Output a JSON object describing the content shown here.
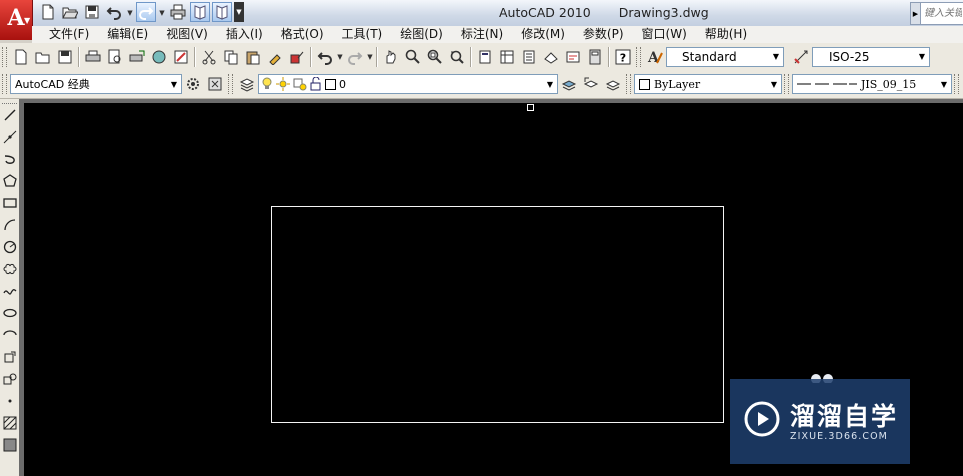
{
  "window": {
    "app_name": "AutoCAD 2010",
    "document": "Drawing3.dwg",
    "search_placeholder": "键入关键字或短语"
  },
  "menubar": {
    "items": [
      "文件(F)",
      "编辑(E)",
      "视图(V)",
      "插入(I)",
      "格式(O)",
      "工具(T)",
      "绘图(D)",
      "标注(N)",
      "修改(M)",
      "参数(P)",
      "窗口(W)",
      "帮助(H)"
    ]
  },
  "styles_toolbar": {
    "text_style": "Standard",
    "dim_style": "ISO-25"
  },
  "workspace_toolbar": {
    "workspace": "AutoCAD 经典",
    "layer": "0",
    "color": "ByLayer",
    "linetype": "JIS_09_15"
  },
  "watermark": {
    "title": "溜溜自学",
    "url": "ZIXUE.3D66.COM"
  },
  "colors": {
    "canvas": "#000000",
    "logo_red": "#c8201a",
    "watermark_blue": "#1e406e"
  }
}
